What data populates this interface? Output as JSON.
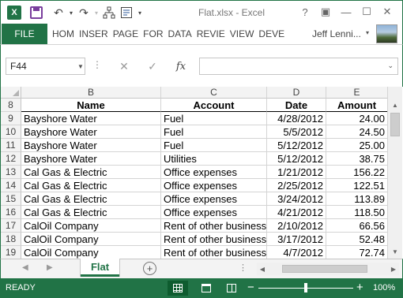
{
  "window": {
    "title": "Flat.xlsx - Excel",
    "help_glyph": "?",
    "restore_glyph": "▣",
    "minimize_glyph": "—",
    "maximize_glyph": "☐",
    "close_glyph": "✕"
  },
  "qat": {
    "app_icon": "X",
    "undo_glyph": "↶",
    "redo_glyph": "↷",
    "caret_glyph": "▾",
    "customize_glyph": "▾"
  },
  "ribbon": {
    "file_tab": "FILE",
    "tabs": [
      "HOM",
      "INSER",
      "PAGE",
      "FOR",
      "DATA",
      "REVIE",
      "VIEW",
      "DEVE"
    ],
    "user_name": "Jeff Lenni...",
    "user_caret": "▾"
  },
  "formula_bar": {
    "name_box": "F44",
    "name_caret": "▼",
    "dots": "⋮",
    "cancel_glyph": "✕",
    "enter_glyph": "✓",
    "fx_label": "fx",
    "formula_value": "",
    "expand_glyph": "⌄"
  },
  "grid": {
    "column_headers": [
      "B",
      "C",
      "D",
      "E"
    ],
    "rows": [
      {
        "num": "8",
        "b": "Name",
        "c": "Account",
        "d": "Date",
        "e": "Amount",
        "header": true
      },
      {
        "num": "9",
        "b": "Bayshore Water",
        "c": "Fuel",
        "d": "4/28/2012",
        "e": "24.00"
      },
      {
        "num": "10",
        "b": "Bayshore Water",
        "c": "Fuel",
        "d": "5/5/2012",
        "e": "24.50"
      },
      {
        "num": "11",
        "b": "Bayshore Water",
        "c": "Fuel",
        "d": "5/12/2012",
        "e": "25.00"
      },
      {
        "num": "12",
        "b": "Bayshore Water",
        "c": "Utilities",
        "d": "5/12/2012",
        "e": "38.75"
      },
      {
        "num": "13",
        "b": "Cal Gas & Electric",
        "c": "Office expenses",
        "d": "1/21/2012",
        "e": "156.22"
      },
      {
        "num": "14",
        "b": "Cal Gas & Electric",
        "c": "Office expenses",
        "d": "2/25/2012",
        "e": "122.51"
      },
      {
        "num": "15",
        "b": "Cal Gas & Electric",
        "c": "Office expenses",
        "d": "3/24/2012",
        "e": "113.89"
      },
      {
        "num": "16",
        "b": "Cal Gas & Electric",
        "c": "Office expenses",
        "d": "4/21/2012",
        "e": "118.50"
      },
      {
        "num": "17",
        "b": "CalOil Company",
        "c": "Rent of other business",
        "d": "2/10/2012",
        "e": "66.56"
      },
      {
        "num": "18",
        "b": "CalOil Company",
        "c": "Rent of other business",
        "d": "3/17/2012",
        "e": "52.48"
      },
      {
        "num": "19",
        "b": "CalOil Company",
        "c": "Rent of other business",
        "d": "4/7/2012",
        "e": "72.74"
      }
    ]
  },
  "scroll": {
    "up_glyph": "▲",
    "down_glyph": "▼",
    "left_glyph": "◀",
    "right_glyph": "▶"
  },
  "sheets": {
    "prev_glyph": "◀",
    "next_glyph": "▶",
    "active_tab": "Flat",
    "add_glyph": "+",
    "dots": "⋮"
  },
  "status": {
    "text": "READY",
    "zoom_minus": "−",
    "zoom_plus": "+",
    "zoom_label": "100%",
    "zoom_level": 0.5
  },
  "colors": {
    "accent": "#217346",
    "grid_line": "#d4d4d4",
    "header_bg": "#f3f3f3"
  }
}
